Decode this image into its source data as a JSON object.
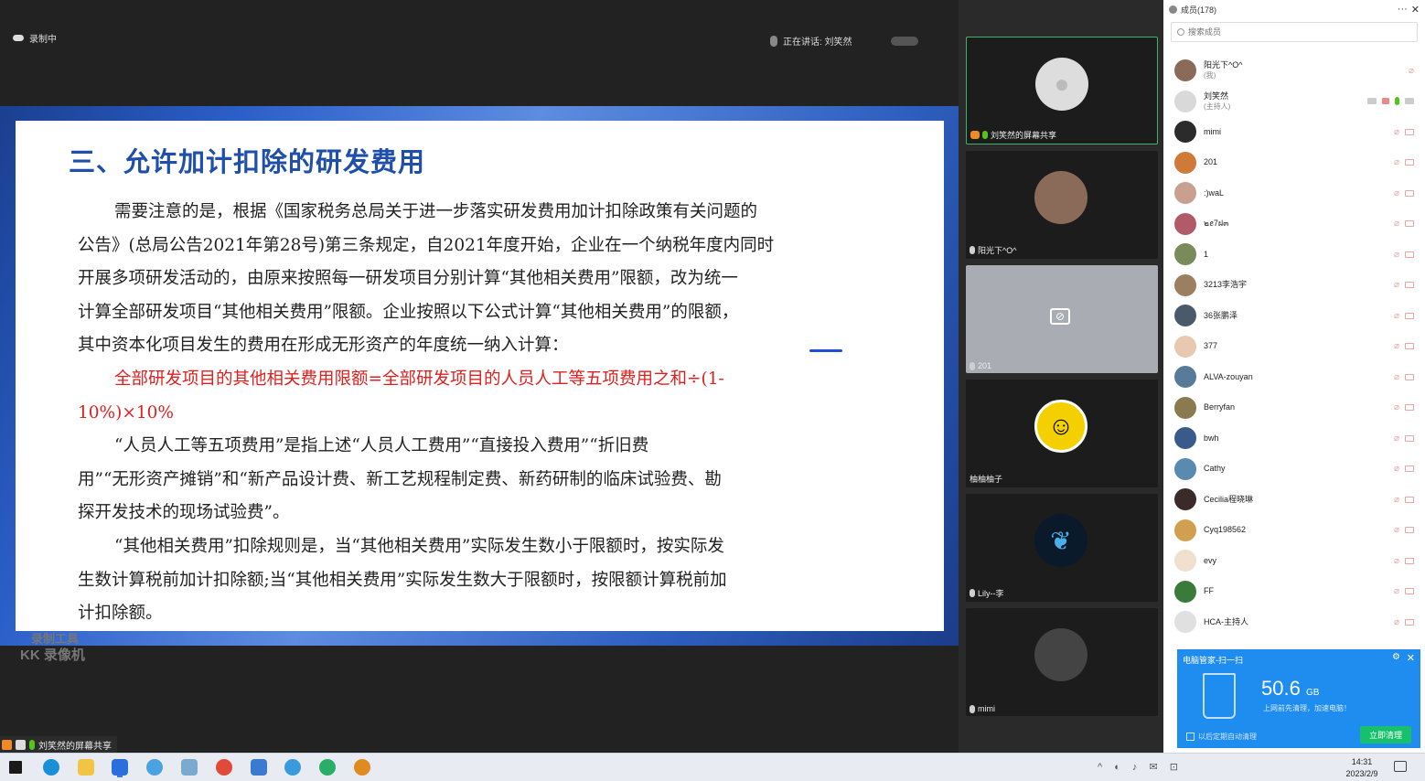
{
  "recording_label": "录制中",
  "speaking_label": "正在讲话: 刘笑然",
  "slide": {
    "title": "三、允许加计扣除的研发费用",
    "p1_line1": "需要注意的是，根据《国家税务总局关于进一步落实研发费用加计扣除政策有关问题的",
    "p1_line2": "公告》(总局公告2021年第28号)第三条规定，自2021年度开始，企业在一个纳税年度内同时",
    "p1_line3": "开展多项研发活动的，由原来按照每一研发项目分别计算“其他相关费用”限额，改为统一",
    "p1_line4": "计算全部研发项目“其他相关费用”限额。企业按照以下公式计算“其他相关费用”的限额，",
    "p1_line5": "其中资本化项目发生的费用在形成无形资产的年度统一纳入计算：",
    "formula_line1": "全部研发项目的其他相关费用限额=全部研发项目的人员人工等五项费用之和÷(1-",
    "formula_line2": "10%)×10%",
    "p2_line1": "“人员人工等五项费用”是指上述“人员人工费用”“直接投入费用”“折旧费",
    "p2_line2": "用”“无形资产摊销”和“新产品设计费、新工艺规程制定费、新药研制的临床试验费、勘",
    "p2_line3": "探开发技术的现场试验费”。",
    "p3_line1": "“其他相关费用”扣除规则是，当“其他相关费用”实际发生数小于限额时，按实际发",
    "p3_line2": "生数计算税前加计扣除额;当“其他相关费用”实际发生数大于限额时，按限额计算税前加",
    "p3_line3": "计扣除额。"
  },
  "watermark": {
    "line1": "录制工具",
    "line2": "KK 录像机"
  },
  "share_label": "刘笑然的屏幕共享",
  "tiles": [
    {
      "label": "刘笑然的屏幕共享"
    },
    {
      "label": "阳光下^O^"
    },
    {
      "label": "201"
    },
    {
      "label": "柚柚柚子"
    },
    {
      "label": "Lily--李"
    },
    {
      "label": "mimi"
    }
  ],
  "panel": {
    "title": "成员(178)",
    "more": "···",
    "close": "✕",
    "search_placeholder": "搜索成员",
    "members": [
      {
        "name": "阳光下^O^",
        "sub": "(我)",
        "color": "#8a6b5a"
      },
      {
        "name": "刘笑然",
        "sub": "(主持人)",
        "color": "#d9d9d9"
      },
      {
        "name": "mimi",
        "sub": "",
        "color": "#2b2b2b"
      },
      {
        "name": "201",
        "sub": "",
        "color": "#d07a3a"
      },
      {
        "name": ":)waL",
        "sub": "",
        "color": "#c9a090"
      },
      {
        "name": "๒ꫀ7ฝ๓",
        "sub": "",
        "color": "#b05a6a"
      },
      {
        "name": "1",
        "sub": "",
        "color": "#7a8a5a"
      },
      {
        "name": "3213李浩宇",
        "sub": "",
        "color": "#9a8060"
      },
      {
        "name": "36张鹏泽",
        "sub": "",
        "color": "#4a5a6a"
      },
      {
        "name": "377",
        "sub": "",
        "color": "#e8c8b0"
      },
      {
        "name": "ALVA-zouyan",
        "sub": "",
        "color": "#5a7a9a"
      },
      {
        "name": "Berryfan",
        "sub": "",
        "color": "#8a7a50"
      },
      {
        "name": "bwh",
        "sub": "",
        "color": "#3a5a8a"
      },
      {
        "name": "Cathy",
        "sub": "",
        "color": "#5a8ab0"
      },
      {
        "name": "Cecilia程晓琳",
        "sub": "",
        "color": "#3a2a2a"
      },
      {
        "name": "Cyq198562",
        "sub": "",
        "color": "#d0a050"
      },
      {
        "name": "evy",
        "sub": "",
        "color": "#f0e0d0"
      },
      {
        "name": "FF",
        "sub": "",
        "color": "#3a7a3a"
      },
      {
        "name": "HCA-主持人",
        "sub": "",
        "color": "#e0e0e0"
      }
    ]
  },
  "popup": {
    "title": "电脑管家-扫一扫",
    "size": "50.6",
    "unit": "GB",
    "message": "上网前先清理，加速电脑！",
    "checkbox": "以后定期自动清理",
    "button": "立即清理"
  },
  "taskbar": {
    "tray": "^ ◐ ♪ ✉ ⊡",
    "time": "14:31",
    "date": "2023/2/9"
  }
}
